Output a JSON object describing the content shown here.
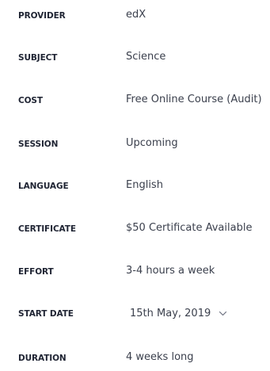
{
  "course_details": {
    "rows": [
      {
        "label": "PROVIDER",
        "value": "edX"
      },
      {
        "label": "SUBJECT",
        "value": "Science"
      },
      {
        "label": "COST",
        "value": "Free Online Course (Audit)"
      },
      {
        "label": "SESSION",
        "value": "Upcoming"
      },
      {
        "label": "LANGUAGE",
        "value": "English"
      },
      {
        "label": "CERTIFICATE",
        "value": "$50 Certificate Available"
      },
      {
        "label": "EFFORT",
        "value": "3-4 hours a week"
      },
      {
        "label": "START DATE",
        "value": "15th May, 2019",
        "icon": "chevron-down-icon"
      },
      {
        "label": "DURATION",
        "value": "4 weeks long"
      }
    ]
  }
}
